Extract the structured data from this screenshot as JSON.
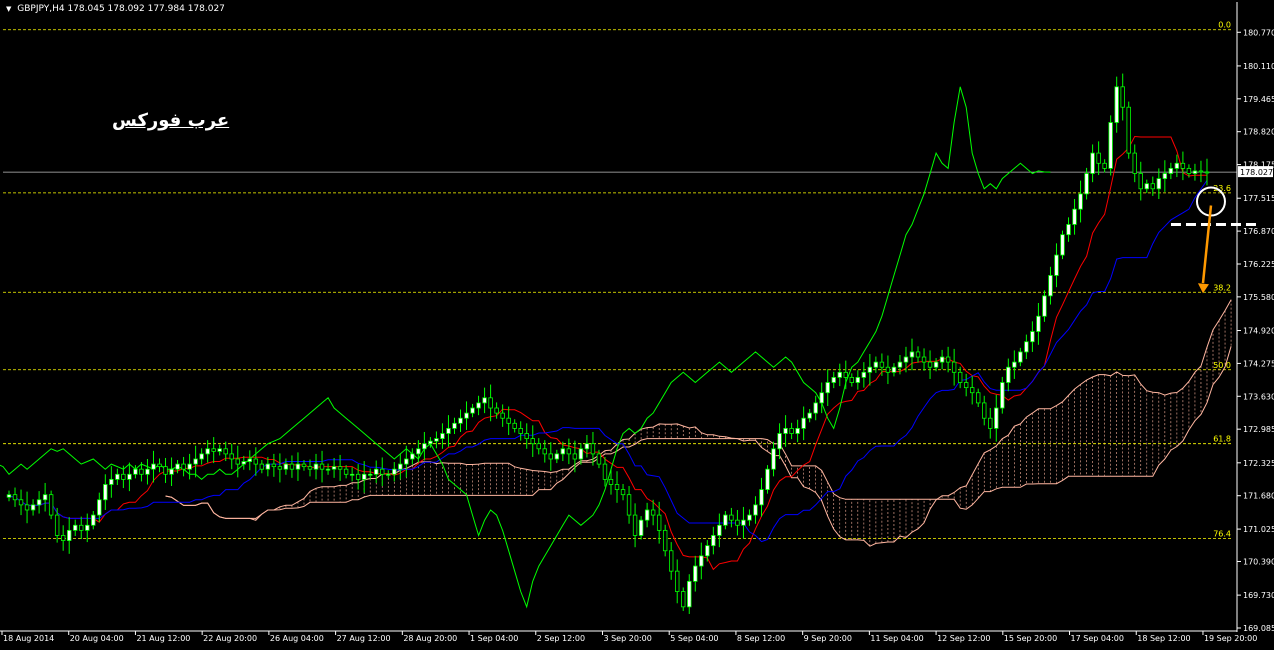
{
  "header": {
    "symbol": "GBPJPY,H4",
    "ohlc": "178.045 178.092 177.984 178.027"
  },
  "watermark": {
    "brand_text": "عرب فوركس"
  },
  "current_price_label": "178.027",
  "colors": {
    "background": "#000000",
    "bull_candle": "#ffffff",
    "bear_candle": "#000000",
    "candle_wick": "#00ff00",
    "tenkan": "#ff0000",
    "kijun": "#0000ff",
    "chikou": "#00ff00",
    "senkou_a_b": "#ffb6a0",
    "fibo": "#ffff00",
    "arrow": "#ff9900",
    "price_line": "#c0c0c0"
  },
  "chart_data": {
    "type": "candlestick",
    "title": "",
    "xlabel": "",
    "ylabel": "",
    "ylim": [
      169.085,
      181.05
    ],
    "y_ticks": [
      "180.770",
      "180.110",
      "179.465",
      "178.820",
      "178.175",
      "177.515",
      "176.870",
      "176.225",
      "175.580",
      "174.920",
      "174.275",
      "173.630",
      "172.985",
      "172.325",
      "171.680",
      "171.025",
      "170.390",
      "169.730",
      "169.085"
    ],
    "x_ticks": [
      "18 Aug 2014",
      "20 Aug 04:00",
      "21 Aug 12:00",
      "22 Aug 20:00",
      "26 Aug 04:00",
      "27 Aug 12:00",
      "28 Aug 20:00",
      "1 Sep 04:00",
      "2 Sep 12:00",
      "3 Sep 20:00",
      "5 Sep 04:00",
      "8 Sep 12:00",
      "9 Sep 20:00",
      "11 Sep 04:00",
      "12 Sep 12:00",
      "15 Sep 20:00",
      "17 Sep 04:00",
      "18 Sep 12:00",
      "19 Sep 20:00"
    ],
    "x_tick_count_total_bars": 200,
    "fibonacci_levels": [
      {
        "label": "0.0",
        "price": 180.82
      },
      {
        "label": "23.6",
        "price": 177.62
      },
      {
        "label": "38.2",
        "price": 175.67
      },
      {
        "label": "50.0",
        "price": 174.15
      },
      {
        "label": "61.8",
        "price": 172.7
      },
      {
        "label": "76.4",
        "price": 170.84
      }
    ],
    "candles_close": [
      171.7,
      171.6,
      171.5,
      171.4,
      171.5,
      171.6,
      171.7,
      171.3,
      170.9,
      170.8,
      171.0,
      171.1,
      171.0,
      171.1,
      171.3,
      171.6,
      171.9,
      172.0,
      172.1,
      172.0,
      172.1,
      172.2,
      172.1,
      172.2,
      172.3,
      172.25,
      172.1,
      172.2,
      172.3,
      172.2,
      172.3,
      172.4,
      172.5,
      172.6,
      172.55,
      172.6,
      172.5,
      172.4,
      172.3,
      172.35,
      172.4,
      172.3,
      172.2,
      172.3,
      172.25,
      172.2,
      172.3,
      172.2,
      172.3,
      172.25,
      172.2,
      172.3,
      172.2,
      172.2,
      172.25,
      172.2,
      172.1,
      172.1,
      172.0,
      172.1,
      172.1,
      172.2,
      172.1,
      172.1,
      172.2,
      172.3,
      172.4,
      172.5,
      172.6,
      172.7,
      172.75,
      172.8,
      172.9,
      173.0,
      173.1,
      173.2,
      173.3,
      173.4,
      173.5,
      173.6,
      173.4,
      173.3,
      173.2,
      173.1,
      173.0,
      172.9,
      172.8,
      172.7,
      172.6,
      172.5,
      172.4,
      172.5,
      172.6,
      172.5,
      172.4,
      172.6,
      172.7,
      172.5,
      172.3,
      172.0,
      171.9,
      171.8,
      171.7,
      171.3,
      170.9,
      171.2,
      171.4,
      171.3,
      171.0,
      170.6,
      170.2,
      169.8,
      169.5,
      170.0,
      170.3,
      170.5,
      170.7,
      170.9,
      171.1,
      171.3,
      171.2,
      171.1,
      171.2,
      171.3,
      171.5,
      171.8,
      172.2,
      172.6,
      172.9,
      173.0,
      172.9,
      173.0,
      173.2,
      173.3,
      173.5,
      173.7,
      173.9,
      174.0,
      174.1,
      174.0,
      173.9,
      174.0,
      174.1,
      174.2,
      174.3,
      174.2,
      174.1,
      174.2,
      174.3,
      174.4,
      174.5,
      174.4,
      174.3,
      174.2,
      174.3,
      174.4,
      174.3,
      174.1,
      173.9,
      173.8,
      173.7,
      173.5,
      173.2,
      173.0,
      173.4,
      173.9,
      174.2,
      174.3,
      174.5,
      174.7,
      174.9,
      175.2,
      175.6,
      176.0,
      176.4,
      176.8,
      177.0,
      177.3,
      177.6,
      178.0,
      178.4,
      178.2,
      178.1,
      179.0,
      179.7,
      179.3,
      178.4,
      178.0,
      177.7,
      177.8,
      177.7,
      177.9,
      178.0,
      178.1,
      178.2,
      178.1,
      178.0,
      178.05,
      178.03,
      178.027
    ],
    "series": [
      {
        "name": "",
        "role": "tenkan"
      },
      {
        "name": "",
        "role": "kijun"
      },
      {
        "name": "",
        "role": "chikou"
      },
      {
        "name": "",
        "role": "kumo"
      }
    ]
  }
}
